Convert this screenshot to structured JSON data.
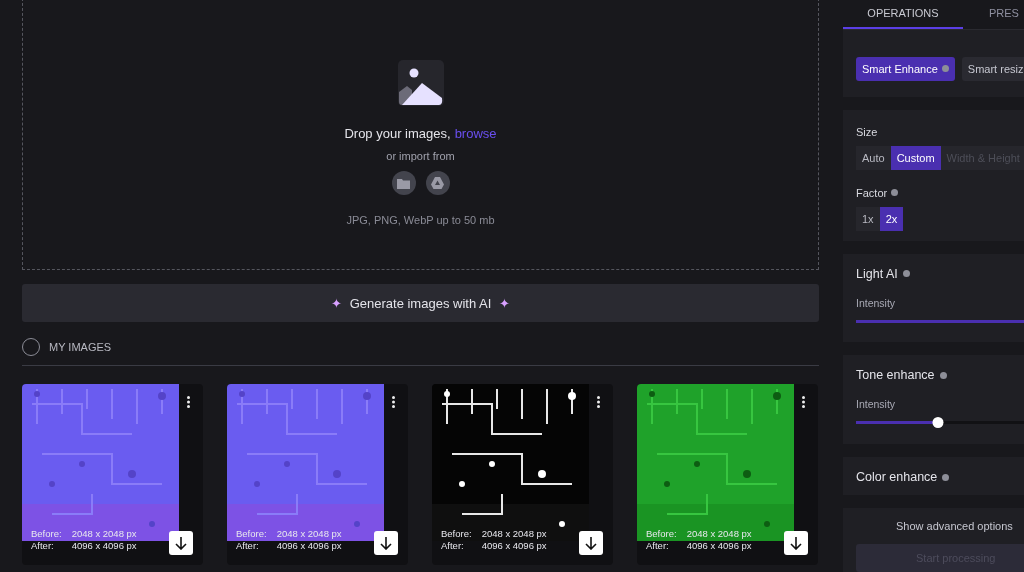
{
  "upload": {
    "prompt": "Drop your images,",
    "browse": "browse",
    "import_label": "or import from",
    "formats": "JPG, PNG, WebP up to 50 mb"
  },
  "generate_button": {
    "star_left": "✦",
    "label": "Generate images with AI",
    "star_right": "✦"
  },
  "my_images": {
    "title": "MY IMAGES",
    "select_all": {
      "checked": false
    }
  },
  "images": [
    {
      "before_label": "Before:",
      "before": "2048 x 2048 px",
      "after_label": "After:",
      "after": "4096 x 4096 px"
    },
    {
      "before_label": "Before:",
      "before": "2048 x 2048 px",
      "after_label": "After:",
      "after": "4096 x 4096 px"
    },
    {
      "before_label": "Before:",
      "before": "2048 x 2048 px",
      "after_label": "After:",
      "after": "4096 x 4096 px"
    },
    {
      "before_label": "Before:",
      "before": "2048 x 2048 px",
      "after_label": "After:",
      "after": "4096 x 4096 px"
    }
  ],
  "tabs": [
    {
      "label": "OPERATIONS",
      "selected": true
    },
    {
      "label": "PRES",
      "selected": false
    }
  ],
  "upscale_chips": [
    {
      "label": "Smart Enhance",
      "selected": true,
      "info": true
    },
    {
      "label": "Smart resiz",
      "selected": false,
      "info": false
    }
  ],
  "size": {
    "title": "Size",
    "options": [
      {
        "label": "Auto",
        "selected": false,
        "disabled": false
      },
      {
        "label": "Custom",
        "selected": true,
        "disabled": false
      },
      {
        "label": "Width & Height",
        "selected": false,
        "disabled": true
      }
    ]
  },
  "factor": {
    "title": "Factor",
    "options": [
      {
        "label": "1x",
        "selected": false
      },
      {
        "label": "2x",
        "selected": true
      }
    ]
  },
  "sections": [
    {
      "kind": "slider",
      "title": "Light AI",
      "slider_label": "Intensity",
      "level": 1,
      "thumb": false
    },
    {
      "kind": "slider",
      "title": "Tone enhance",
      "slider_label": "Intensity",
      "level": 0.49,
      "thumb": true
    },
    {
      "kind": "plain",
      "title": "Color enhance"
    }
  ],
  "advanced_link": "Show advanced options",
  "start_button": {
    "label": "Start processing",
    "disabled": true
  }
}
